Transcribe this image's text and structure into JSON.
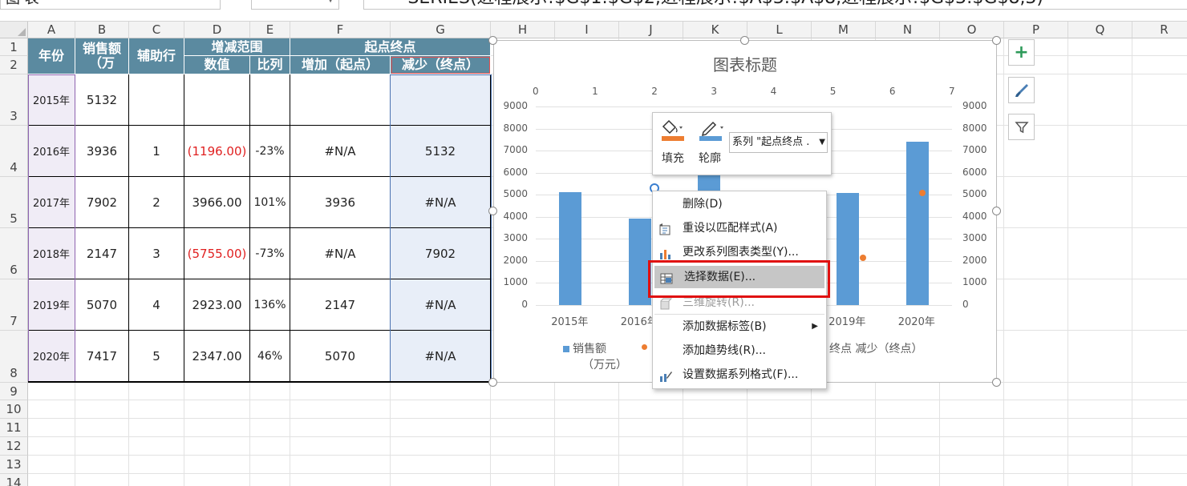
{
  "formula_bar": {
    "name_box": "图 表",
    "formula": "=SERIES(进程展示!$G$1:$G$2,进程展示!$A$3:$A$8,进程展示!$G$3:$G$8,3)"
  },
  "columns": [
    "A",
    "B",
    "C",
    "D",
    "E",
    "F",
    "G",
    "H",
    "I",
    "J",
    "K",
    "L",
    "M",
    "N",
    "O",
    "P",
    "Q",
    "R"
  ],
  "rows": [
    "1",
    "2",
    "3",
    "4",
    "5",
    "6",
    "7",
    "8",
    "9",
    "10",
    "11",
    "12",
    "13",
    "14"
  ],
  "table": {
    "headers": {
      "year": "年份",
      "sales": "销售额（万",
      "helper": "辅助行",
      "range": "增减范围",
      "value": "数值",
      "ratio": "比列",
      "startend": "起点终点",
      "increase": "增加（起点）",
      "decrease": "减少（终点）"
    },
    "rows": [
      {
        "year": "2015年",
        "sales": "5132",
        "helper": "",
        "value": "",
        "ratio": "",
        "inc": "",
        "dec": ""
      },
      {
        "year": "2016年",
        "sales": "3936",
        "helper": "1",
        "value": "(1196.00)",
        "ratio": "-23%",
        "inc": "#N/A",
        "dec": "5132"
      },
      {
        "year": "2017年",
        "sales": "7902",
        "helper": "2",
        "value": "3966.00",
        "ratio": "101%",
        "inc": "3936",
        "dec": "#N/A"
      },
      {
        "year": "2018年",
        "sales": "2147",
        "helper": "3",
        "value": "(5755.00)",
        "ratio": "-73%",
        "inc": "#N/A",
        "dec": "7902"
      },
      {
        "year": "2019年",
        "sales": "5070",
        "helper": "4",
        "value": "2923.00",
        "ratio": "136%",
        "inc": "2147",
        "dec": "#N/A"
      },
      {
        "year": "2020年",
        "sales": "7417",
        "helper": "5",
        "value": "2347.00",
        "ratio": "46%",
        "inc": "5070",
        "dec": "#N/A"
      }
    ]
  },
  "chart": {
    "title": "图表标题",
    "legend": {
      "sales": "销售额",
      "sales_unit": "（万元）",
      "decrease_tail": "终点 减少（终点）"
    }
  },
  "chart_data": {
    "type": "bar",
    "title": "图表标题",
    "categories": [
      "2015年",
      "2016年",
      "2017年",
      "2018年",
      "2019年",
      "2020年"
    ],
    "series": [
      {
        "name": "销售额（万元）",
        "values": [
          5132,
          3936,
          7902,
          2147,
          5070,
          7417
        ]
      },
      {
        "name": "减少（终点）",
        "type": "scatter",
        "x": [
          5.5,
          6.5
        ],
        "values": [
          2147,
          5070
        ]
      }
    ],
    "ylim": [
      0,
      9000
    ],
    "y_ticks": [
      "0",
      "1000",
      "2000",
      "3000",
      "4000",
      "5000",
      "6000",
      "7000",
      "8000",
      "9000"
    ],
    "x2_ticks": [
      "0",
      "1",
      "2",
      "3",
      "4",
      "5",
      "6",
      "7"
    ],
    "x2lim": [
      0,
      7
    ]
  },
  "format_toolbar": {
    "fill_label": "填充",
    "outline_label": "轮廓",
    "series_select": "系列 \"起点终点 ."
  },
  "context_menu": {
    "items": [
      {
        "label": "删除(D)",
        "icon": "delete-icon",
        "disabled": false,
        "selected": false
      },
      {
        "label": "重设以匹配样式(A)",
        "icon": "reset-style-icon",
        "disabled": false,
        "selected": false
      },
      {
        "label": "更改系列图表类型(Y)...",
        "icon": "chart-type-icon",
        "disabled": false,
        "selected": false
      },
      {
        "label": "选择数据(E)...",
        "icon": "select-data-icon",
        "disabled": false,
        "selected": true
      },
      {
        "label": "三维旋转(R)...",
        "icon": "rotate-3d-icon",
        "disabled": true,
        "selected": false
      },
      {
        "label": "添加数据标签(B)",
        "icon": "",
        "disabled": false,
        "selected": false
      },
      {
        "label": "添加趋势线(R)...",
        "icon": "",
        "disabled": false,
        "selected": false
      },
      {
        "label": "设置数据系列格式(F)...",
        "icon": "format-series-icon",
        "disabled": false,
        "selected": false
      }
    ]
  },
  "colors": {
    "header_fill": "#5b8aa0",
    "bar": "#5b9bd5",
    "point": "#ed7d31",
    "highlight_box": "#e01010"
  }
}
